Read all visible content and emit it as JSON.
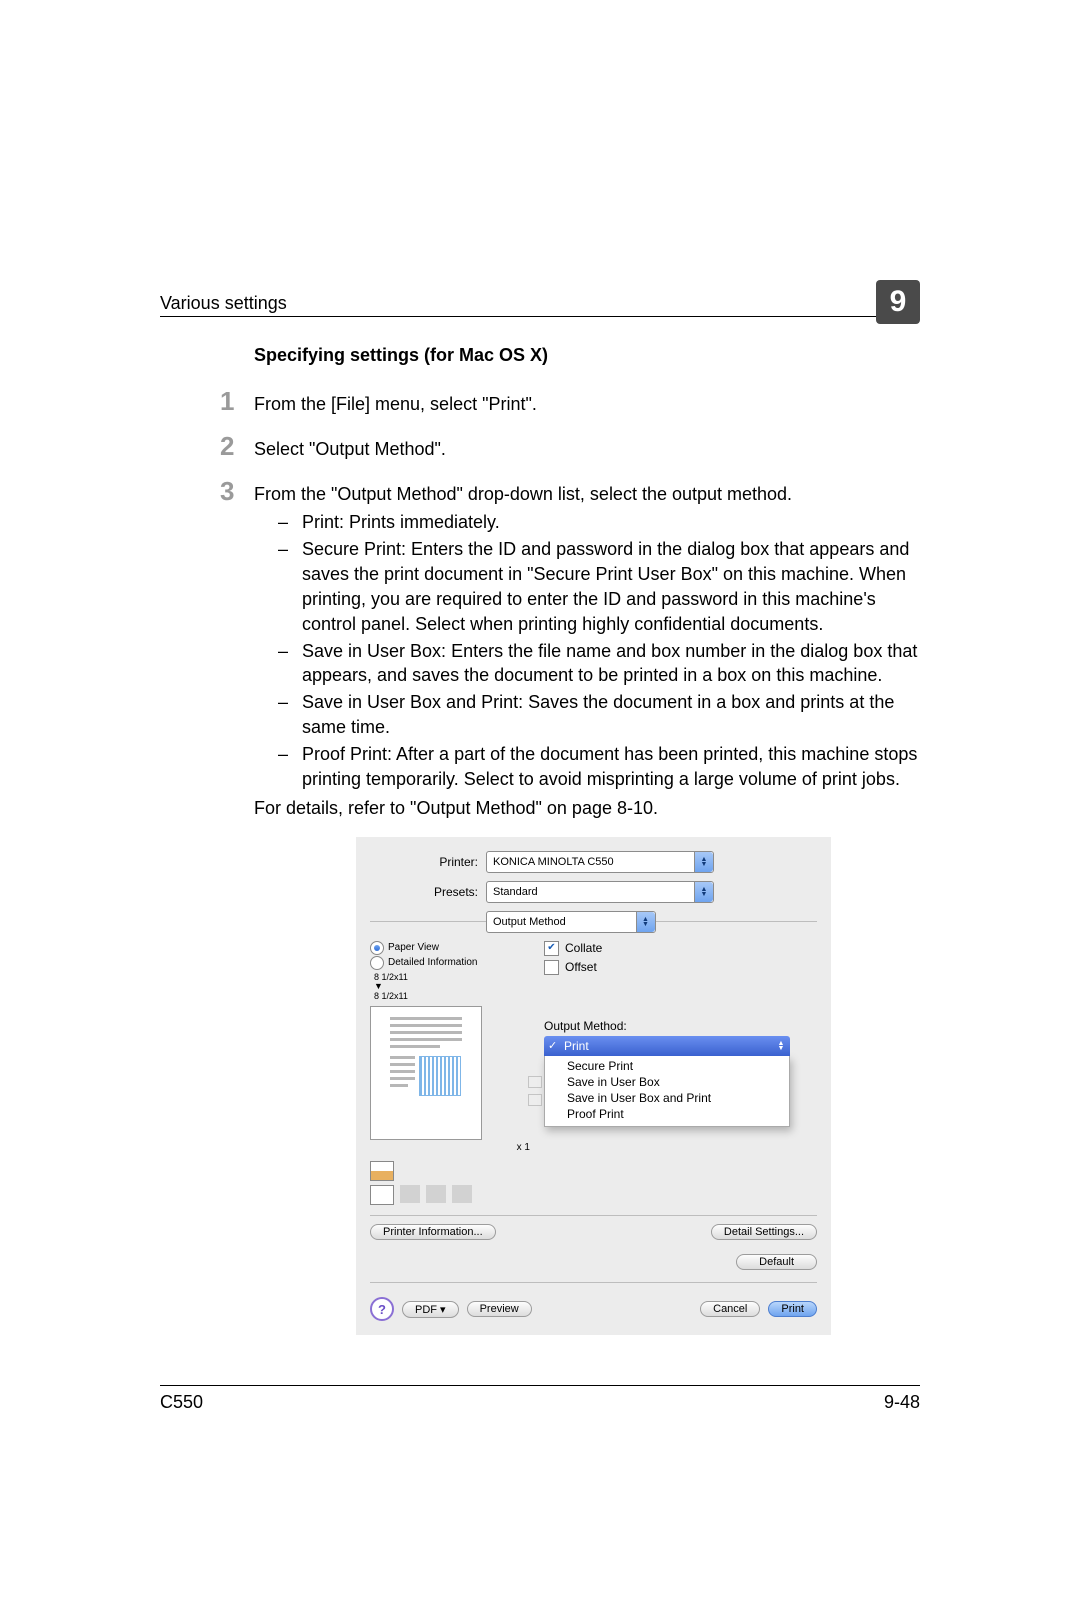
{
  "header": {
    "title": "Various settings",
    "chapter": "9"
  },
  "section_heading": "Specifying settings (for Mac OS X)",
  "steps": [
    {
      "num": "1",
      "text": "From the [File] menu, select \"Print\"."
    },
    {
      "num": "2",
      "text": "Select \"Output Method\"."
    },
    {
      "num": "3",
      "text": "From the \"Output Method\" drop-down list, select the output method."
    }
  ],
  "sub_items": [
    "Print: Prints immediately.",
    "Secure Print: Enters the ID and password in the dialog box that appears and saves the print document in \"Secure Print User Box\" on this machine. When printing, you are required to enter the ID and password in this machine's control panel. Select when printing highly confidential documents.",
    "Save in User Box: Enters the file name and box number in the dialog box that appears, and saves the document to be printed in a box on this machine.",
    "Save in User Box and Print: Saves the document in a box and prints at the same time.",
    "Proof Print: After a part of the document has been printed, this machine stops printing temporarily. Select to avoid misprinting a large volume of print jobs."
  ],
  "details_line": "For details, refer to \"Output Method\" on page 8-10.",
  "dialog": {
    "printer_label": "Printer:",
    "printer_value": "KONICA MINOLTA C550",
    "presets_label": "Presets:",
    "presets_value": "Standard",
    "panel_value": "Output Method",
    "paper_view": "Paper View",
    "detailed_info": "Detailed Information",
    "paper_size_top": "8 1/2x11",
    "paper_size_bottom": "8 1/2x11",
    "x_count": "x 1",
    "printer_info_btn": "Printer Information...",
    "collate": "Collate",
    "offset": "Offset",
    "method_label": "Output Method:",
    "method_selected": "Print",
    "method_options": [
      "Secure Print",
      "Save in User Box",
      "Save in User Box and Print",
      "Proof Print"
    ],
    "detail_settings_btn": "Detail Settings...",
    "default_btn": "Default",
    "pdf_btn": "PDF ▾",
    "preview_btn": "Preview",
    "cancel_btn": "Cancel",
    "print_btn": "Print"
  },
  "footer": {
    "model": "C550",
    "page": "9-48"
  }
}
